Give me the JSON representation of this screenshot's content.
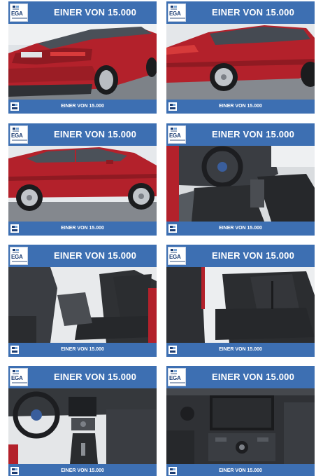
{
  "gallery": {
    "cards": [
      {
        "header": "EINER VON 15.000",
        "logo": "EGA",
        "footer": "EINER VON 15.000",
        "photo": "red-sedan-rear-three-quarter"
      },
      {
        "header": "EINER VON 15.000",
        "logo": "EGA",
        "footer": "EINER VON 15.000",
        "photo": "red-sedan-rear-side"
      },
      {
        "header": "EINER VON 15.000",
        "logo": "EGA",
        "footer": "EINER VON 15.000",
        "photo": "red-sedan-side-profile"
      },
      {
        "header": "EINER VON 15.000",
        "logo": "EGA",
        "footer": "EINER VON 15.000",
        "photo": "interior-cockpit-door-open"
      },
      {
        "header": "EINER VON 15.000",
        "logo": "EGA",
        "footer": "EINER VON 15.000",
        "photo": "front-seats-driver-side"
      },
      {
        "header": "EINER VON 15.000",
        "logo": "EGA",
        "footer": "EINER VON 15.000",
        "photo": "rear-seats"
      },
      {
        "header": "EINER VON 15.000",
        "logo": "EGA",
        "footer": "EINER VON 15.000",
        "photo": "dashboard-steering-wheel"
      },
      {
        "header": "EINER VON 15.000",
        "logo": "EGA",
        "footer": "EINER VON 15.000",
        "photo": "center-console-screen"
      }
    ]
  },
  "colors": {
    "banner_blue": "#3d6fb2",
    "car_red": "#b3212b",
    "seat_dark": "#2b2d30"
  }
}
